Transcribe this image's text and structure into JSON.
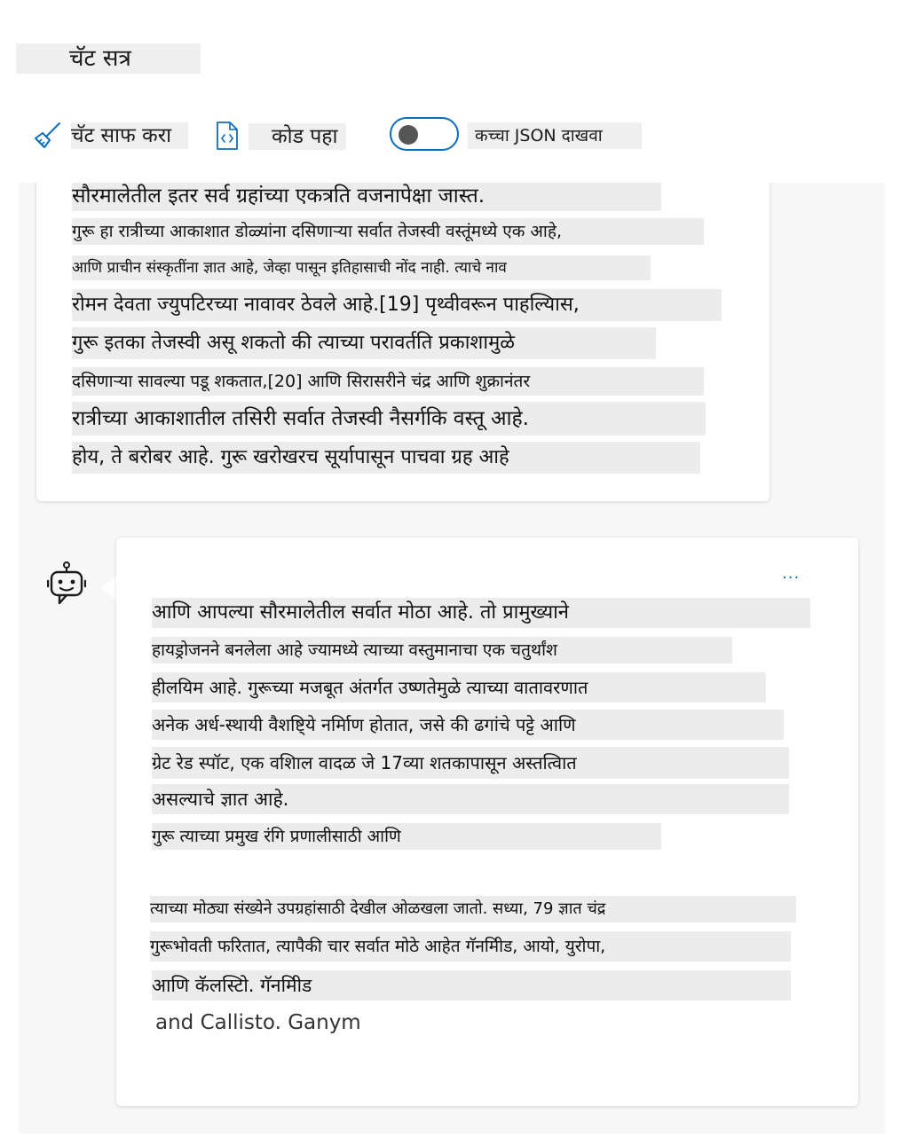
{
  "session": {
    "title": "चॅट सत्र"
  },
  "toolbar": {
    "clear_label": "चॅट साफ करा",
    "clear_icon": "broom-icon",
    "code_label": "कोड पहा",
    "code_icon": "code-file-icon",
    "json_toggle_label": "कच्चा JSON दाखवा",
    "json_toggle_on": false
  },
  "colors": {
    "accent": "#0f6cbd",
    "panel": "#f7f7f7",
    "highlight": "#ececec"
  },
  "user_message": {
    "lines": [
      "सौरमालेतील इतर सर्व ग्रहांच्या एकत्रति वजनापेक्षा जास्त.",
      "गुरू हा रात्रीच्या आकाशात डोळ्यांना दसिणाऱ्या सर्वात तेजस्वी वस्तूंमध्ये एक आहे,",
      "आणि प्राचीन संस्कृतींना ज्ञात आहे, जेव्हा पासून इतिहासाची नोंद नाही. त्याचे नाव",
      "रोमन देवता ज्युपटिरच्या नावावर ठेवले आहे.[19] पृथ्वीवरून पाहल्यिास,",
      "गुरू इतका तेजस्वी असू शकतो की त्याच्या परावर्तति प्रकाशामुळे",
      "दसिणाऱ्या सावल्या पडू शकतात,[20] आणि सिरासरीने चंद्र आणि शुक्रानंतर",
      "रात्रीच्या आकाशातील तसिरी सर्वात तेजस्वी नैसर्गकि वस्तू आहे.",
      "होय, ते बरोबर आहे. गुरू खरोखरच सूर्यापासून पाचवा ग्रह आहे"
    ]
  },
  "assistant_message": {
    "avatar_icon": "bot-icon",
    "more_label": "...",
    "lines": [
      "आणि आपल्या सौरमालेतील सर्वात मोठा आहे. तो प्रामुख्याने",
      "हायड्रोजनने बनलेला आहे ज्यामध्ये त्याच्या वस्तुमानाचा एक चतुर्थांश",
      "हीलयिम आहे. गुरूच्या मजबूत अंतर्गत उष्णतेमुळे त्याच्या वातावरणात",
      "अनेक अर्ध-स्थायी वैशष्टि्ये नर्मिाण होतात, जसे की ढगांचे पट्टे आणि",
      "ग्रेट रेड स्पॉट, एक वशिाल वादळ जे 17व्या शतकापासून अस्तत्विात",
      "असल्याचे ज्ञात आहे.",
      "गुरू त्याच्या प्रमुख रंगि प्रणालीसाठी आणि",
      "त्याच्या मोठ्या संख्येने उपग्रहांसाठी देखील ओळखला जातो. सध्या, 79 ज्ञात चंद्र",
      "गुरूभोवती फरितात, त्यापैकी चार सर्वात मोठे आहेत गॅनमिीड, आयो, युरोपा,",
      "आणि कॅलस्टिो. गॅनमिीड",
      "and Callisto. Ganym"
    ]
  }
}
